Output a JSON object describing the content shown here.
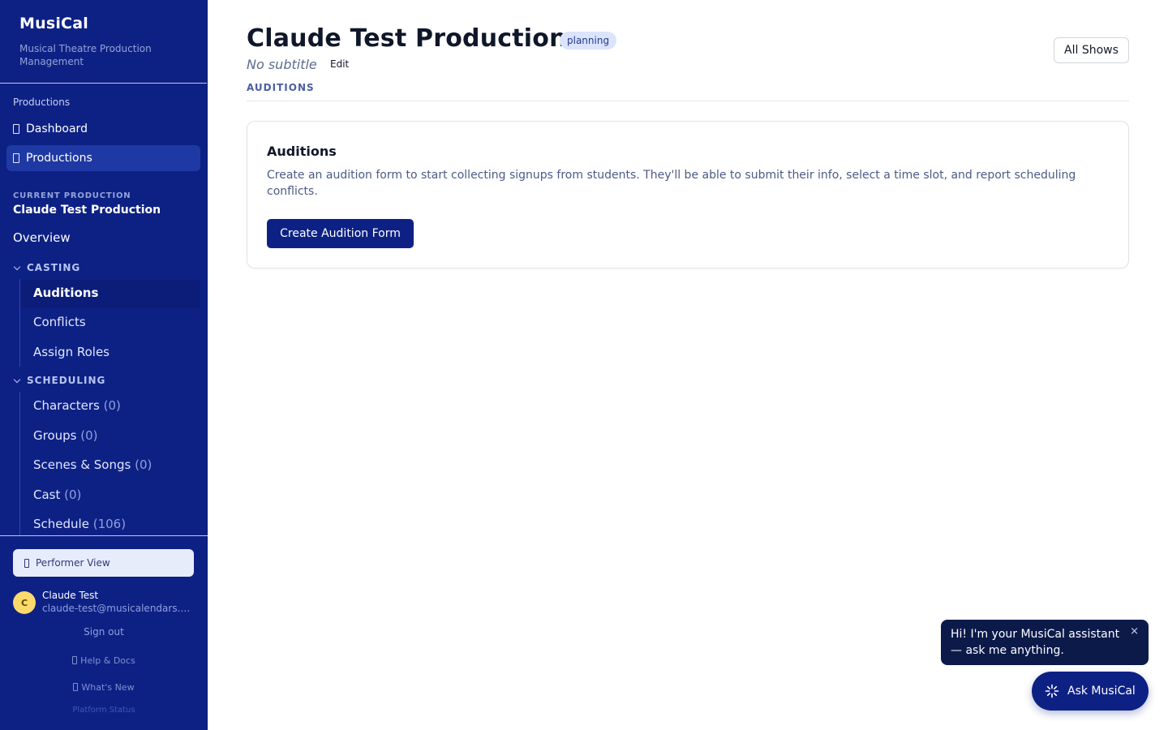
{
  "brand": {
    "title": "MusiCal",
    "subtitle": "Musical Theatre Production Management"
  },
  "nav": {
    "section_label": "Productions",
    "items": [
      {
        "label": "Dashboard",
        "icon": "dashboard-icon"
      },
      {
        "label": "Productions",
        "icon": "productions-icon",
        "active": true
      }
    ]
  },
  "current_production": {
    "label": "CURRENT PRODUCTION",
    "name": "Claude Test Production",
    "overview": "Overview"
  },
  "casting": {
    "heading": "CASTING",
    "items": [
      {
        "label": "Auditions",
        "active": true
      },
      {
        "label": "Conflicts"
      },
      {
        "label": "Assign Roles"
      }
    ]
  },
  "scheduling": {
    "heading": "SCHEDULING",
    "items": [
      {
        "label": "Characters",
        "count": "(0)"
      },
      {
        "label": "Groups",
        "count": "(0)"
      },
      {
        "label": "Scenes & Songs",
        "count": "(0)"
      },
      {
        "label": "Cast",
        "count": "(0)"
      },
      {
        "label": "Schedule",
        "count": "(106)"
      }
    ]
  },
  "footer": {
    "performer_view": "Performer View",
    "user_initial": "C",
    "user_name": "Claude Test",
    "user_email": "claude-test@musicalendars.com",
    "sign_out": "Sign out",
    "help": "Help & Docs",
    "whats_new": "What's New",
    "platform_status": "Platform Status"
  },
  "header": {
    "title": "Claude Test Production",
    "status_badge": "planning",
    "subtitle": "No subtitle",
    "edit": "Edit",
    "all_shows": "All Shows",
    "tab": "AUDITIONS"
  },
  "card": {
    "title": "Auditions",
    "text": "Create an audition form to start collecting signups from students. They'll be able to submit their info, select a time slot, and report scheduling conflicts.",
    "button": "Create Audition Form"
  },
  "assistant": {
    "tooltip": "Hi! I'm your MusiCal assistant — ask me anything.",
    "close": "×",
    "button": "Ask MusiCal"
  },
  "colors": {
    "sidebar": "#0d2185",
    "primary": "#0d2185",
    "badge_bg": "#dbe4fb",
    "tooltip_bg": "#0c1a4a"
  }
}
